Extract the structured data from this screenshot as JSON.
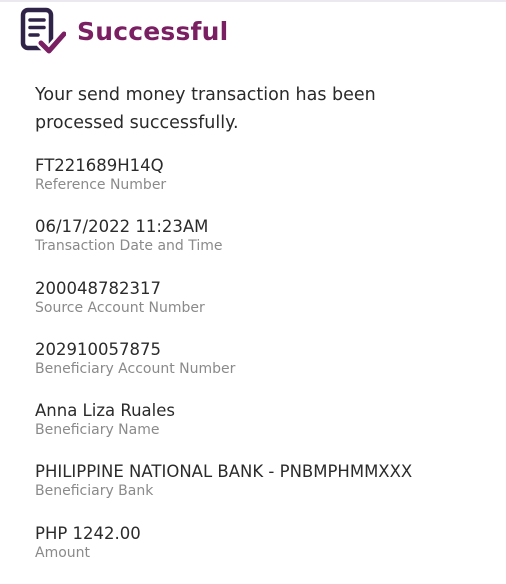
{
  "header": {
    "icon": "document-check-icon",
    "title": "Successful",
    "accent_color": "#7b1f63"
  },
  "message": "Your send money transaction has been processed successfully.",
  "fields": [
    {
      "value": "FT221689H14Q",
      "label": "Reference Number"
    },
    {
      "value": "06/17/2022 11:23AM",
      "label": "Transaction Date and Time"
    },
    {
      "value": "200048782317",
      "label": "Source Account Number"
    },
    {
      "value": "202910057875",
      "label": "Beneficiary Account Number"
    },
    {
      "value": "Anna Liza Ruales",
      "label": "Beneficiary Name"
    },
    {
      "value": "PHILIPPINE NATIONAL BANK - PNBMPHMMXXX",
      "label": "Beneficiary Bank"
    },
    {
      "value": "PHP 1242.00",
      "label": "Amount"
    }
  ]
}
